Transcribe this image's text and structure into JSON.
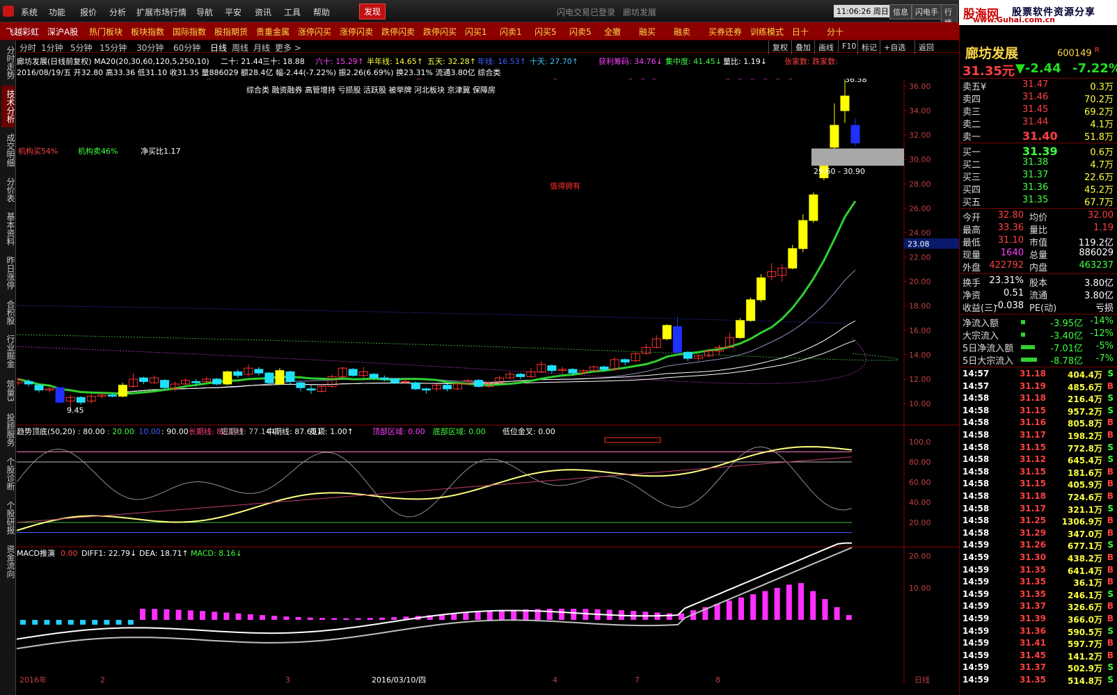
{
  "menu": {
    "items": [
      "系统",
      "功能",
      "报价",
      "分析",
      "扩展市场行情",
      "导航",
      "平安",
      "资讯",
      "工具",
      "帮助"
    ],
    "active": "发现",
    "center": [
      "闪电交易已登录",
      "廊坊发展"
    ],
    "time": "11:06:26",
    "weekday": "周日",
    "buttons": [
      "信息",
      "闪电手",
      "行情"
    ]
  },
  "banner": {
    "site": "股海网",
    "slogan": "股票软件资源分享",
    "url": "www.Guhai.com.cn"
  },
  "hotbar": [
    "飞越彩虹",
    "深沪A股",
    "热门板块",
    "板块指数",
    "国际指数",
    "股指期货",
    "贵重金属",
    "涨停闪买",
    "涨停闪卖",
    "跌停闪卖",
    "跌停闪买",
    "闪买1",
    "闪卖1",
    "闪买5",
    "闪卖5",
    "全撤",
    "融买",
    "融卖",
    "买券还券",
    "训练模式",
    "日十",
    "分十"
  ],
  "leftnav": [
    "分时走势",
    "技术分析",
    "成交明细",
    "分价表",
    "基本资料",
    "昨日涨停",
    "合积股",
    "行业掘金",
    "筑量3",
    "投顾服务",
    "个股诊断",
    "个股研报",
    "资金流向"
  ],
  "periods": [
    "分时",
    "1分钟",
    "5分钟",
    "15分钟",
    "30分钟",
    "60分钟",
    "日线",
    "周线",
    "月线",
    "更多 >"
  ],
  "period_selected": "日线",
  "toolbar": [
    "复权",
    "叠加",
    "画线",
    "F10",
    "标记",
    "+自选",
    "返回"
  ],
  "info": {
    "line1_title": "廊坊发展(日线前复权) MA20(20,30,60,120,5,250,10)",
    "ma": [
      {
        "label": "二十: 21.44",
        "color": "#ffffff"
      },
      {
        "label": "三十: 18.88",
        "color": "#ffffff"
      },
      {
        "label": "六十: 15.29↑",
        "color": "#ff40ff"
      },
      {
        "label": "半年线: 14.65↑",
        "color": "#ffff40"
      },
      {
        "label": "五天: 32.28↑",
        "color": "#ffff40"
      },
      {
        "label": "年线: 16.53↑",
        "color": "#4060ff"
      },
      {
        "label": "十天: 27.70↑",
        "color": "#40c0ff"
      },
      {
        "label": "获利筹码: 34.76↓",
        "color": "#ff40ff"
      },
      {
        "label": "集中度: 41.45↓",
        "color": "#40ff40"
      },
      {
        "label": "量比: 1.19↓",
        "color": "#ffffff"
      },
      {
        "label": "张家数: 跌家数:",
        "color": "#ff4040"
      }
    ],
    "line2": "2016/08/19/五 开32.80 高33.36 低31.10 收31.35 量886029 额28.4亿 幅-2.44(-7.22%) 振2.26(6.69%) 换23.31% 流通3.80亿 综合类"
  },
  "chart_labels": {
    "tags": "综合类 融资融券 高管增持 亏损股 活跃股 被举牌 河北板块 京津冀 保障房",
    "inst_buy": "机构买54%",
    "inst_sell": "机构卖46%",
    "net_ratio": "净买比1.17",
    "note": "值得拥有",
    "high_label": "36.58",
    "low_label": "9.45",
    "zone_label": "29.60 - 30.90",
    "cursor_price": "23.08"
  },
  "sub1": {
    "title": "趋势顶底(50,20)",
    "params": [
      {
        "label": ": 80.00",
        "color": "#ffffff"
      },
      {
        "label": ": 20.00",
        "color": "#40ff40"
      },
      {
        "label": ": 10.00",
        "color": "#4060ff"
      },
      {
        "label": ": 90.00",
        "color": "#ffffff"
      },
      {
        "label": "长期线: 82.17↑",
        "color": "#ff4080"
      },
      {
        "label": "短期线: 77.14↓",
        "color": "#c0c0c0"
      },
      {
        "label": "中期线: 87.65↓",
        "color": "#ffffff"
      },
      {
        "label": "见顶: 1.00↑",
        "color": "#ffffff"
      },
      {
        "label": "顶部区域: 0.00",
        "color": "#ff40ff"
      },
      {
        "label": "底部区域: 0.00",
        "color": "#40ff40"
      },
      {
        "label": "低位金叉: 0.00",
        "color": "#ffffff"
      }
    ]
  },
  "sub2": {
    "title": "MACD推演",
    "params": [
      {
        "label": "0.00",
        "color": "#ff4040"
      },
      {
        "label": "DIFF1: 22.79↓",
        "color": "#ffffff"
      },
      {
        "label": "DEA: 18.71↑",
        "color": "#ffffff"
      },
      {
        "label": "MACD: 8.16↓",
        "color": "#40ff40"
      }
    ]
  },
  "axis": {
    "price_ticks": [
      "36.00",
      "34.00",
      "32.00",
      "30.00",
      "28.00",
      "26.00",
      "24.00",
      "22.00",
      "20.00",
      "18.00",
      "16.00",
      "14.00",
      "12.00",
      "10.00"
    ],
    "sub1_ticks": [
      "100.0",
      "80.00",
      "60.00",
      "40.00",
      "20.00"
    ],
    "sub2_ticks": [
      "20.00",
      "10.00"
    ],
    "date_labels": [
      "2016年",
      "2",
      "3",
      "2016/03/10/四",
      "4",
      "7",
      "8",
      "日线"
    ]
  },
  "panel": {
    "name": "廊坊发展",
    "code": "600149",
    "badge": "R",
    "price": "31.35元",
    "change": "▼-2.44",
    "pct": "-7.22%",
    "sells": [
      {
        "label": "卖五",
        "mark": "¥",
        "price": "31.47",
        "vol": "0.3万"
      },
      {
        "label": "卖四",
        "mark": "",
        "price": "31.46",
        "vol": "70.2万"
      },
      {
        "label": "卖三",
        "mark": "",
        "price": "31.45",
        "vol": "69.2万"
      },
      {
        "label": "卖二",
        "mark": "",
        "price": "31.44",
        "vol": "4.1万"
      },
      {
        "label": "卖一",
        "mark": "",
        "price": "31.40",
        "vol": "51.8万"
      }
    ],
    "buys": [
      {
        "label": "买一",
        "price": "31.39",
        "vol": "0.6万"
      },
      {
        "label": "买二",
        "price": "31.38",
        "vol": "4.7万"
      },
      {
        "label": "买三",
        "price": "31.37",
        "vol": "22.6万"
      },
      {
        "label": "买四",
        "price": "31.36",
        "vol": "45.2万"
      },
      {
        "label": "买五",
        "price": "31.35",
        "vol": "67.7万"
      }
    ],
    "stats": [
      {
        "k1": "今开",
        "v1": "32.80",
        "c1": "#ff4040",
        "k2": "均价",
        "v2": "32.00",
        "c2": "#ff4040"
      },
      {
        "k1": "最高",
        "v1": "33.36",
        "c1": "#ff4040",
        "k2": "量比",
        "v2": "1.19",
        "c2": "#ff4040"
      },
      {
        "k1": "最低",
        "v1": "31.10",
        "c1": "#ff4040",
        "k2": "市值",
        "v2": "119.2亿",
        "c2": "#ffffff"
      },
      {
        "k1": "现量",
        "v1": "1640",
        "c1": "#ff40ff",
        "k2": "总量",
        "v2": "886029",
        "c2": "#ffffff"
      },
      {
        "k1": "外盘",
        "v1": "422792",
        "c1": "#ff4040",
        "k2": "内盘",
        "v2": "463237",
        "c2": "#40ff40"
      }
    ],
    "stats2": [
      {
        "k1": "换手",
        "v1": "23.31%",
        "k2": "股本",
        "v2": "3.80亿"
      },
      {
        "k1": "净资",
        "v1": "0.51",
        "k2": "流通",
        "v2": "3.80亿"
      },
      {
        "k1": "收益(三)",
        "v1": "-0.038",
        "k2": "PE(动)",
        "v2": "亏损"
      }
    ],
    "flows": [
      {
        "label": "净流入额",
        "value": "-3.95亿",
        "pct": "-14%",
        "bar": 0.04
      },
      {
        "label": "大宗流入",
        "value": "-3.40亿",
        "pct": "-12%",
        "bar": 0.04
      },
      {
        "label": "5日净流入额",
        "value": "-7.01亿",
        "pct": "-5%",
        "bar": 0.65
      },
      {
        "label": "5日大宗流入",
        "value": "-8.78亿",
        "pct": "-7%",
        "bar": 0.75
      }
    ],
    "ticks": [
      {
        "t": "14:57",
        "p": "31.18",
        "v": "404.4万",
        "s": "S"
      },
      {
        "t": "14:57",
        "p": "31.19",
        "v": "485.6万",
        "s": "B"
      },
      {
        "t": "14:58",
        "p": "31.18",
        "v": "216.4万",
        "s": "S"
      },
      {
        "t": "14:58",
        "p": "31.15",
        "v": "957.2万",
        "s": "S"
      },
      {
        "t": "14:58",
        "p": "31.16",
        "v": "805.8万",
        "s": "B"
      },
      {
        "t": "14:58",
        "p": "31.17",
        "v": "198.2万",
        "s": "B"
      },
      {
        "t": "14:58",
        "p": "31.15",
        "v": "772.8万",
        "s": "S"
      },
      {
        "t": "14:58",
        "p": "31.12",
        "v": "645.4万",
        "s": "S"
      },
      {
        "t": "14:58",
        "p": "31.15",
        "v": "181.6万",
        "s": "B"
      },
      {
        "t": "14:58",
        "p": "31.15",
        "v": "405.9万",
        "s": "B"
      },
      {
        "t": "14:58",
        "p": "31.18",
        "v": "724.6万",
        "s": "B"
      },
      {
        "t": "14:58",
        "p": "31.17",
        "v": "321.1万",
        "s": "S"
      },
      {
        "t": "14:58",
        "p": "31.25",
        "v": "1306.9万",
        "s": "B"
      },
      {
        "t": "14:58",
        "p": "31.29",
        "v": "347.0万",
        "s": "B"
      },
      {
        "t": "14:59",
        "p": "31.26",
        "v": "677.1万",
        "s": "S"
      },
      {
        "t": "14:59",
        "p": "31.30",
        "v": "438.2万",
        "s": "B"
      },
      {
        "t": "14:59",
        "p": "31.35",
        "v": "641.4万",
        "s": "B"
      },
      {
        "t": "14:59",
        "p": "31.35",
        "v": "36.1万",
        "s": "B"
      },
      {
        "t": "14:59",
        "p": "31.35",
        "v": "246.1万",
        "s": "S"
      },
      {
        "t": "14:59",
        "p": "31.37",
        "v": "326.6万",
        "s": "B"
      },
      {
        "t": "14:59",
        "p": "31.39",
        "v": "366.0万",
        "s": "B"
      },
      {
        "t": "14:59",
        "p": "31.36",
        "v": "590.5万",
        "s": "S"
      },
      {
        "t": "14:59",
        "p": "31.41",
        "v": "597.7万",
        "s": "B"
      },
      {
        "t": "14:59",
        "p": "31.45",
        "v": "141.2万",
        "s": "B"
      },
      {
        "t": "14:59",
        "p": "31.37",
        "v": "502.9万",
        "s": "S"
      },
      {
        "t": "14:59",
        "p": "31.35",
        "v": "514.8万",
        "s": "S"
      }
    ]
  },
  "chart_data": {
    "type": "candlestick",
    "price_range": [
      9.45,
      36.58
    ],
    "candles": [
      [
        11.7,
        12.0,
        12.1,
        11.5
      ],
      [
        11.8,
        11.6,
        12.0,
        11.4
      ],
      [
        11.5,
        11.1,
        11.6,
        10.9
      ],
      [
        11.1,
        11.2,
        11.4,
        10.9
      ],
      [
        11.3,
        10.1,
        11.3,
        10.0
      ],
      [
        10.2,
        10.5,
        10.7,
        9.45
      ],
      [
        10.5,
        10.1,
        10.6,
        9.9
      ],
      [
        10.2,
        10.6,
        10.8,
        10.0
      ],
      [
        10.6,
        10.7,
        10.9,
        10.4
      ],
      [
        10.7,
        10.6,
        10.9,
        10.5
      ],
      [
        10.6,
        11.5,
        11.7,
        10.5
      ],
      [
        11.4,
        12.0,
        12.5,
        11.3
      ],
      [
        12.1,
        11.8,
        12.2,
        11.6
      ],
      [
        11.7,
        12.1,
        12.3,
        11.6
      ],
      [
        11.9,
        11.3,
        12.0,
        11.1
      ],
      [
        11.2,
        11.6,
        11.8,
        11.0
      ],
      [
        11.6,
        11.9,
        12.1,
        11.5
      ],
      [
        11.8,
        11.7,
        12.0,
        11.4
      ],
      [
        11.8,
        12.0,
        12.2,
        11.7
      ],
      [
        12.0,
        11.6,
        12.1,
        11.5
      ],
      [
        11.6,
        12.6,
        12.7,
        11.5
      ],
      [
        12.6,
        12.3,
        12.8,
        12.1
      ],
      [
        12.4,
        12.9,
        13.2,
        12.2
      ],
      [
        12.8,
        12.5,
        13.0,
        12.3
      ],
      [
        12.5,
        11.7,
        12.6,
        11.6
      ],
      [
        11.6,
        12.7,
        12.9,
        11.5
      ],
      [
        12.6,
        11.8,
        12.7,
        11.5
      ],
      [
        11.7,
        11.3,
        11.8,
        11.0
      ],
      [
        11.2,
        11.1,
        11.5,
        10.8
      ],
      [
        11.0,
        11.4,
        11.6,
        10.9
      ],
      [
        11.4,
        12.2,
        12.4,
        11.3
      ],
      [
        12.2,
        12.9,
        13.0,
        12.1
      ],
      [
        12.8,
        12.3,
        12.9,
        12.2
      ],
      [
        12.3,
        12.6,
        13.0,
        12.1
      ],
      [
        12.4,
        12.1,
        12.5,
        11.9
      ],
      [
        12.1,
        12.0,
        12.3,
        11.8
      ],
      [
        12.0,
        11.7,
        12.1,
        11.6
      ],
      [
        11.8,
        11.8,
        12.0,
        11.6
      ],
      [
        11.7,
        11.2,
        11.8,
        11.1
      ],
      [
        11.2,
        11.1,
        11.3,
        10.8
      ],
      [
        11.2,
        11.5,
        11.6,
        11.0
      ],
      [
        11.5,
        11.2,
        11.6,
        11.0
      ],
      [
        11.2,
        11.6,
        11.8,
        11.1
      ],
      [
        11.6,
        11.9,
        12.0,
        11.5
      ],
      [
        11.9,
        11.4,
        12.0,
        11.3
      ],
      [
        11.4,
        11.7,
        11.8,
        11.3
      ],
      [
        11.7,
        12.1,
        12.3,
        11.6
      ],
      [
        12.1,
        12.4,
        12.6,
        12.0
      ],
      [
        12.4,
        12.2,
        12.5,
        12.0
      ],
      [
        12.2,
        12.6,
        12.9,
        12.1
      ],
      [
        12.6,
        13.2,
        13.5,
        12.5
      ],
      [
        13.1,
        12.7,
        13.2,
        12.5
      ],
      [
        12.7,
        12.8,
        13.0,
        12.5
      ],
      [
        12.8,
        12.5,
        12.9,
        12.3
      ],
      [
        12.5,
        12.7,
        12.8,
        12.4
      ],
      [
        12.7,
        13.0,
        13.1,
        12.6
      ],
      [
        13.0,
        12.8,
        13.1,
        12.6
      ],
      [
        12.8,
        13.6,
        13.8,
        12.7
      ],
      [
        13.6,
        13.4,
        13.7,
        13.1
      ],
      [
        13.5,
        14.1,
        14.2,
        13.4
      ],
      [
        14.1,
        14.6,
        14.9,
        14.0
      ],
      [
        14.6,
        15.3,
        15.6,
        14.5
      ],
      [
        15.3,
        16.4,
        16.5,
        15.2
      ],
      [
        16.3,
        14.2,
        17.1,
        14.0
      ],
      [
        14.2,
        13.7,
        14.3,
        13.5
      ],
      [
        13.7,
        13.9,
        14.0,
        13.5
      ],
      [
        13.9,
        14.3,
        14.5,
        13.8
      ],
      [
        14.3,
        14.6,
        14.8,
        14.0
      ],
      [
        14.6,
        15.4,
        15.8,
        14.5
      ],
      [
        15.4,
        16.8,
        17.0,
        15.3
      ],
      [
        16.8,
        18.5,
        18.7,
        16.7
      ],
      [
        18.5,
        20.3,
        20.6,
        18.3
      ],
      [
        20.4,
        20.8,
        21.5,
        20.1
      ],
      [
        20.5,
        21.1,
        21.4,
        20.0
      ],
      [
        21.1,
        22.7,
        23.0,
        21.0
      ],
      [
        22.7,
        25.0,
        25.5,
        22.4
      ],
      [
        25.0,
        27.1,
        27.3,
        24.8
      ],
      [
        28.5,
        29.5,
        30.9,
        28.3
      ],
      [
        31.0,
        32.8,
        34.6,
        30.7
      ],
      [
        34.0,
        35.2,
        36.58,
        33.0
      ],
      [
        32.8,
        31.35,
        33.36,
        31.1
      ]
    ],
    "up_colors": {
      "small": "#ff3030",
      "big": "#ffff00"
    },
    "down_colors": {
      "small": "#20e0ff",
      "big": "#2030ff"
    }
  }
}
